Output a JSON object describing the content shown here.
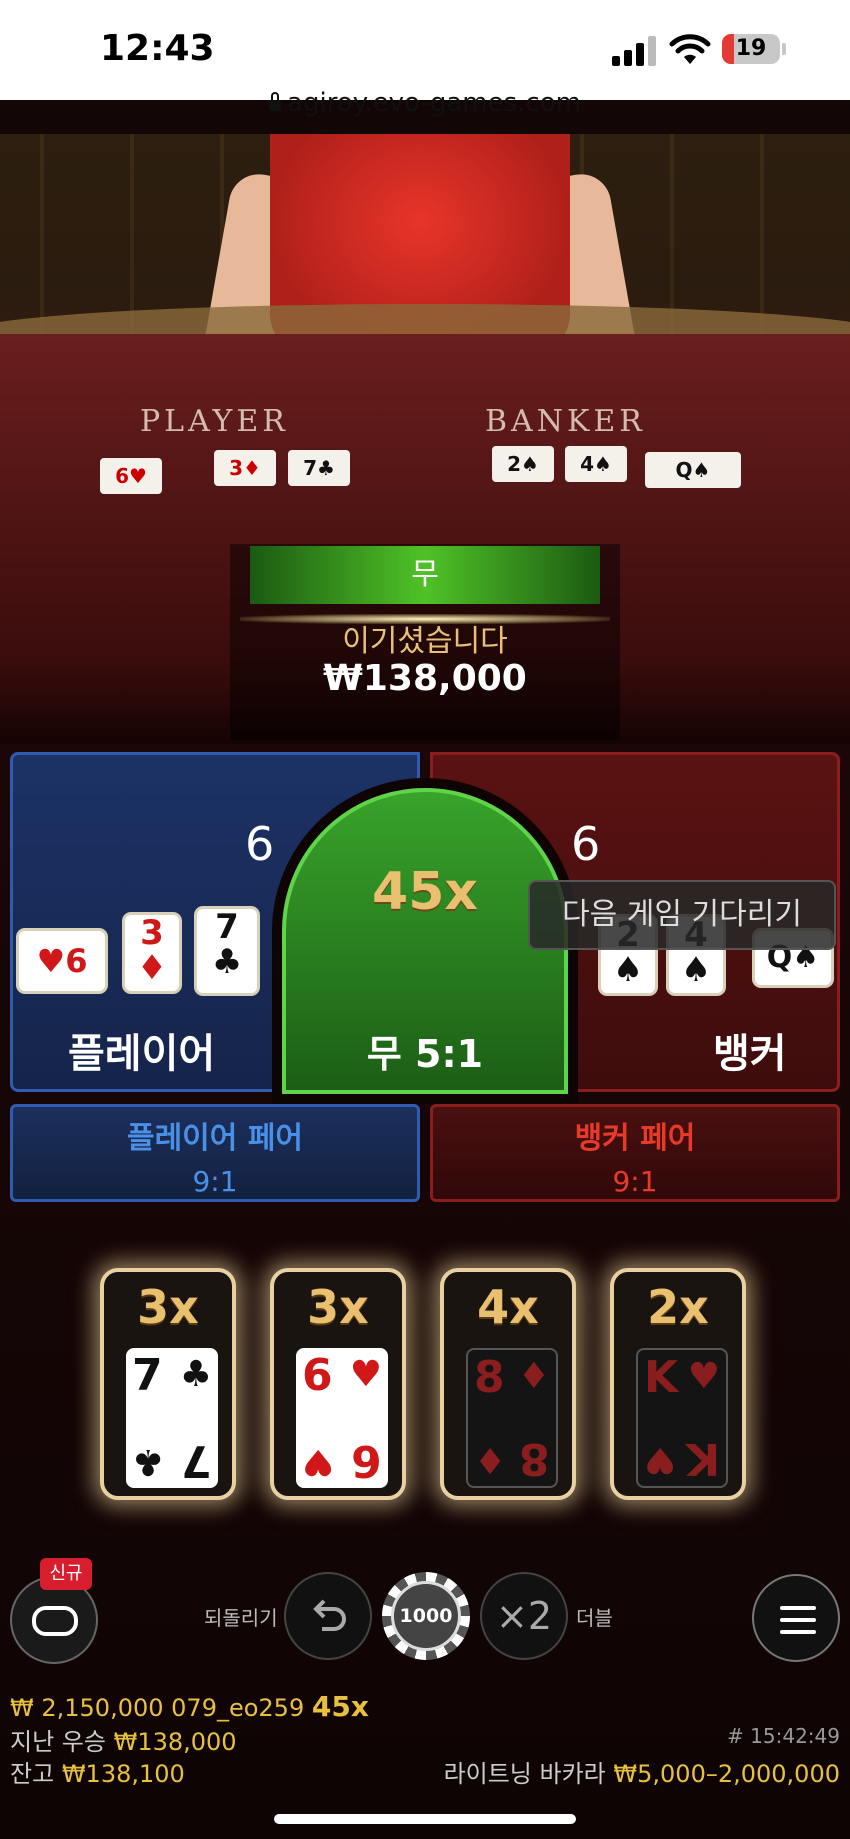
{
  "status_bar": {
    "time": "12:43",
    "battery": "19",
    "url": "agiroy.evo-games.com"
  },
  "video": {
    "table_player_label": "PLAYER",
    "table_banker_label": "BANKER",
    "result": "무",
    "win_text": "이기셨습니다",
    "win_amount": "₩138,000"
  },
  "betting": {
    "player": {
      "score": "6",
      "label": "플레이어",
      "cards": [
        {
          "rank": "6",
          "suit": "♥",
          "color": "red"
        },
        {
          "rank": "3",
          "suit": "♦",
          "color": "red"
        },
        {
          "rank": "7",
          "suit": "♣",
          "color": "black"
        }
      ]
    },
    "tie": {
      "multiplier": "45x",
      "label": "무 5:1"
    },
    "banker": {
      "score": "6",
      "label": "뱅커",
      "cards": [
        {
          "rank": "2",
          "suit": "♠",
          "color": "black"
        },
        {
          "rank": "4",
          "suit": "♠",
          "color": "black"
        },
        {
          "rank": "Q",
          "suit": "♠",
          "color": "black"
        }
      ]
    },
    "waiting_message": "다음 게임 기다리기",
    "player_pair": {
      "name": "플레이어 페어",
      "odds": "9:1"
    },
    "banker_pair": {
      "name": "뱅커 페어",
      "odds": "9:1"
    }
  },
  "lightning_cards": [
    {
      "multiplier": "3x",
      "rank": "7",
      "suit": "♣",
      "color": "black",
      "dark": false
    },
    {
      "multiplier": "3x",
      "rank": "6",
      "suit": "♥",
      "color": "red",
      "dark": false
    },
    {
      "multiplier": "4x",
      "rank": "8",
      "suit": "♦",
      "color": "red",
      "dark": true
    },
    {
      "multiplier": "2x",
      "rank": "K",
      "suit": "♥",
      "color": "red",
      "dark": true
    }
  ],
  "controls": {
    "new_badge": "신규",
    "undo_label": "되돌리기",
    "chip_value": "1000",
    "double_icon": "×2",
    "double_label": "더블",
    "undo_icon": "undo-arrow-icon",
    "menu_icon": "hamburger-menu-icon",
    "chat_icon": "chat-bubble-icon"
  },
  "footer": {
    "winner_line": {
      "amount": "₩ 2,150,000",
      "user": "079_eo259",
      "multiplier": "45x"
    },
    "last_win_label": "지난 우승",
    "last_win_amount": "₩138,000",
    "round_id": "# 15:42:49",
    "balance_label": "잔고",
    "balance_amount": "₩138,100",
    "game_name": "라이트닝 바카라",
    "limits": "₩5,000–2,000,000"
  },
  "colors": {
    "player_blue": "#2f5bb0",
    "banker_red": "#8a1e1e",
    "tie_green": "#38a32a",
    "gold": "#e8c040"
  }
}
